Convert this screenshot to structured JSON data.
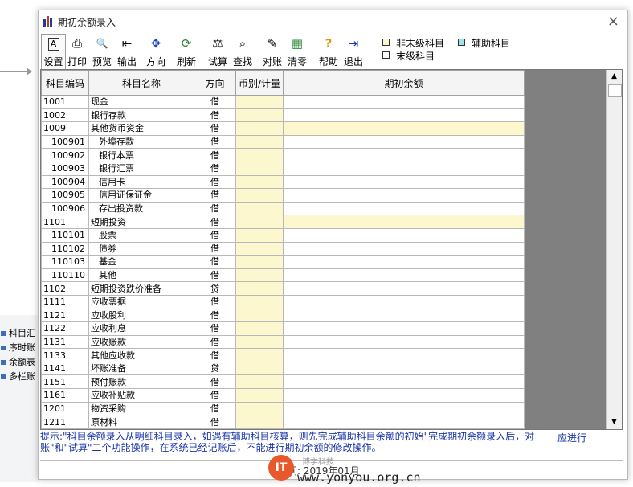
{
  "background_panel": {
    "items": [
      "科目汇",
      "序时账",
      "余额表",
      "多栏账"
    ]
  },
  "dialog": {
    "title": "期初余额录入",
    "close_label": "×"
  },
  "toolbar": {
    "buttons": [
      {
        "label": "设置",
        "icon": "settings-icon",
        "glyph": "A"
      },
      {
        "label": "打印",
        "icon": "printer-icon",
        "glyph": "⎙"
      },
      {
        "label": "预览",
        "icon": "preview-icon",
        "glyph": "🔍"
      },
      {
        "label": "输出",
        "icon": "export-icon",
        "glyph": "⇤"
      },
      {
        "label": "方向",
        "icon": "direction-icon",
        "glyph": "✥"
      },
      {
        "label": "刷新",
        "icon": "refresh-icon",
        "glyph": "⟳"
      },
      {
        "label": "试算",
        "icon": "balance-scale-icon",
        "glyph": "⚖"
      },
      {
        "label": "查找",
        "icon": "find-icon",
        "glyph": "⌕"
      },
      {
        "label": "对账",
        "icon": "reconcile-icon",
        "glyph": "✎"
      },
      {
        "label": "清零",
        "icon": "clear-icon",
        "glyph": "▦"
      },
      {
        "label": "帮助",
        "icon": "help-icon",
        "glyph": "?"
      },
      {
        "label": "退出",
        "icon": "exit-icon",
        "glyph": "⇥"
      }
    ]
  },
  "legend": {
    "non_leaf": {
      "label": "非末级科目",
      "color": "#fdf7cf"
    },
    "auxiliary": {
      "label": "辅助科目",
      "color": "#9fe3ee"
    },
    "leaf": {
      "label": "末级科目",
      "color": "#ffffff"
    }
  },
  "grid": {
    "columns": [
      "科目编码",
      "科目名称",
      "方向",
      "币别/计量",
      "期初余额"
    ],
    "rows": [
      {
        "code": "1001",
        "name": "现金",
        "dir": "借",
        "level": 1,
        "hl": false
      },
      {
        "code": "1002",
        "name": "银行存款",
        "dir": "借",
        "level": 1,
        "hl": false
      },
      {
        "code": "1009",
        "name": "其他货币资金",
        "dir": "借",
        "level": 1,
        "hl": true
      },
      {
        "code": "100901",
        "name": "外埠存款",
        "dir": "借",
        "level": 2,
        "hl": false
      },
      {
        "code": "100902",
        "name": "银行本票",
        "dir": "借",
        "level": 2,
        "hl": false
      },
      {
        "code": "100903",
        "name": "银行汇票",
        "dir": "借",
        "level": 2,
        "hl": false
      },
      {
        "code": "100904",
        "name": "信用卡",
        "dir": "借",
        "level": 2,
        "hl": false
      },
      {
        "code": "100905",
        "name": "信用证保证金",
        "dir": "借",
        "level": 2,
        "hl": false
      },
      {
        "code": "100906",
        "name": "存出投资款",
        "dir": "借",
        "level": 2,
        "hl": false
      },
      {
        "code": "1101",
        "name": "短期投资",
        "dir": "借",
        "level": 1,
        "hl": true
      },
      {
        "code": "110101",
        "name": "股票",
        "dir": "借",
        "level": 2,
        "hl": false
      },
      {
        "code": "110102",
        "name": "债券",
        "dir": "借",
        "level": 2,
        "hl": false
      },
      {
        "code": "110103",
        "name": "基金",
        "dir": "借",
        "level": 2,
        "hl": false
      },
      {
        "code": "110110",
        "name": "其他",
        "dir": "借",
        "level": 2,
        "hl": false
      },
      {
        "code": "1102",
        "name": "短期投资跌价准备",
        "dir": "贷",
        "level": 1,
        "hl": false
      },
      {
        "code": "1111",
        "name": "应收票据",
        "dir": "借",
        "level": 1,
        "hl": false
      },
      {
        "code": "1121",
        "name": "应收股利",
        "dir": "借",
        "level": 1,
        "hl": false
      },
      {
        "code": "1122",
        "name": "应收利息",
        "dir": "借",
        "level": 1,
        "hl": false
      },
      {
        "code": "1131",
        "name": "应收账款",
        "dir": "借",
        "level": 1,
        "hl": false
      },
      {
        "code": "1133",
        "name": "其他应收款",
        "dir": "借",
        "level": 1,
        "hl": false
      },
      {
        "code": "1141",
        "name": "坏账准备",
        "dir": "贷",
        "level": 1,
        "hl": false
      },
      {
        "code": "1151",
        "name": "预付账款",
        "dir": "借",
        "level": 1,
        "hl": false
      },
      {
        "code": "1161",
        "name": "应收补贴款",
        "dir": "借",
        "level": 1,
        "hl": false
      },
      {
        "code": "1201",
        "name": "物资采购",
        "dir": "借",
        "level": 1,
        "hl": false
      },
      {
        "code": "1211",
        "name": "原材料",
        "dir": "借",
        "level": 1,
        "hl": false
      }
    ]
  },
  "hint": {
    "text": "提示:\"科目余额录入从明细科目录入，如遇有辅助科目核算，则先完成辅助科目余额的初始\"完成期初余额录入后，对账\"和\"试算\"二个功能操作，在系统已经记账后，不能进行期初余额的修改操作。",
    "tail": "应进行"
  },
  "status": {
    "text": "期间: 2019年01月"
  },
  "watermark": {
    "sub": "博学科技",
    "url": "www.yonyou.org.cn"
  }
}
